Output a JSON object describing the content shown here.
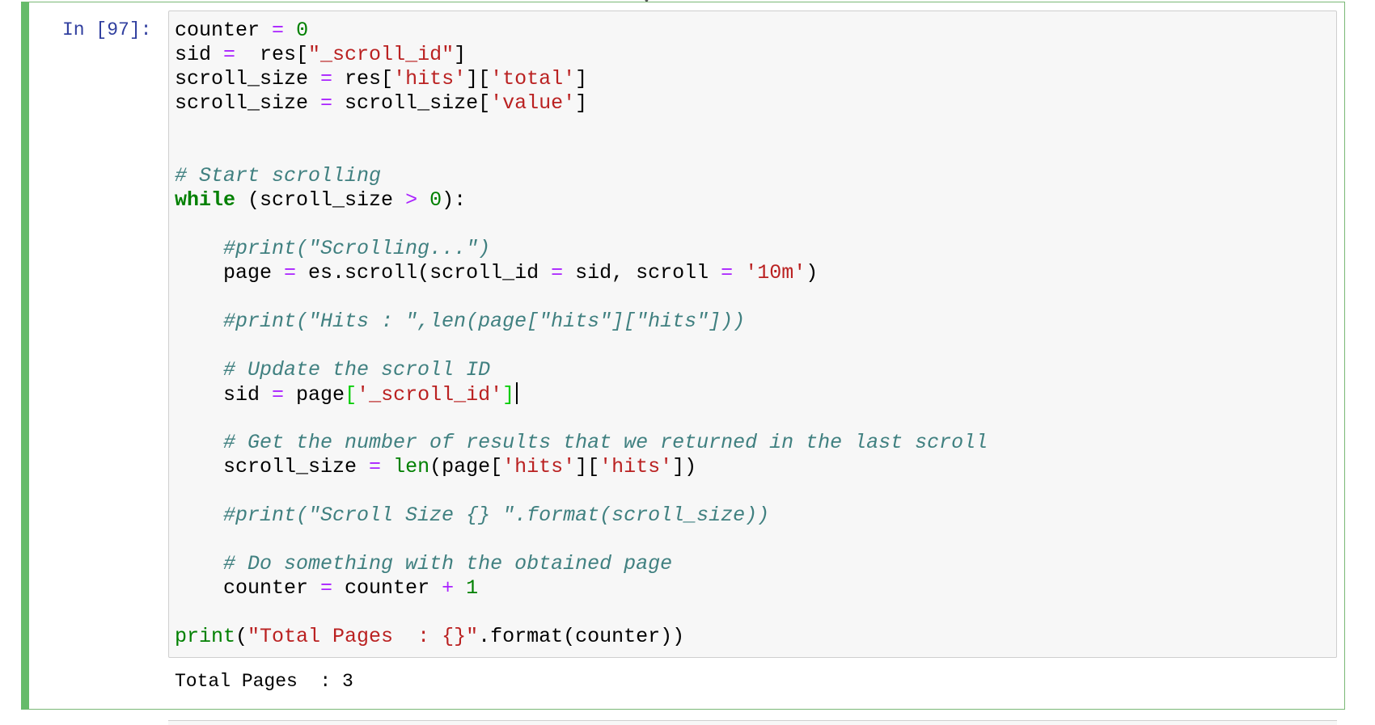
{
  "cell": {
    "prompt": "In [97]:",
    "code_lines": [
      [
        [
          "counter ",
          ""
        ],
        [
          "=",
          "o"
        ],
        [
          " ",
          ""
        ],
        [
          "0",
          "n0"
        ]
      ],
      [
        [
          "sid ",
          ""
        ],
        [
          "=",
          "o"
        ],
        [
          "  res[",
          ""
        ],
        [
          "\"_scroll_id\"",
          "s"
        ],
        [
          "]",
          ""
        ]
      ],
      [
        [
          "scroll_size ",
          ""
        ],
        [
          "=",
          "o"
        ],
        [
          " res[",
          ""
        ],
        [
          "'hits'",
          "s"
        ],
        [
          "][",
          ""
        ],
        [
          "'total'",
          "s"
        ],
        [
          "]",
          ""
        ]
      ],
      [
        [
          "scroll_size ",
          ""
        ],
        [
          "=",
          "o"
        ],
        [
          " scroll_size[",
          ""
        ],
        [
          "'value'",
          "s"
        ],
        [
          "]",
          ""
        ]
      ],
      [],
      [],
      [
        [
          "# Start scrolling",
          "c"
        ]
      ],
      [
        [
          "while",
          "k"
        ],
        [
          " (scroll_size ",
          ""
        ],
        [
          ">",
          "o"
        ],
        [
          " ",
          ""
        ],
        [
          "0",
          "n0"
        ],
        [
          "):",
          ""
        ]
      ],
      [],
      [
        [
          "    ",
          ""
        ],
        [
          "#print(\"Scrolling...\")",
          "c"
        ]
      ],
      [
        [
          "    page ",
          ""
        ],
        [
          "=",
          "o"
        ],
        [
          " es.scroll(scroll_id ",
          ""
        ],
        [
          "=",
          "o"
        ],
        [
          " sid, scroll ",
          ""
        ],
        [
          "=",
          "o"
        ],
        [
          " ",
          ""
        ],
        [
          "'10m'",
          "s"
        ],
        [
          ")",
          ""
        ]
      ],
      [],
      [
        [
          "    ",
          ""
        ],
        [
          "#print(\"Hits : \",len(page[\"hits\"][\"hits\"]))",
          "c"
        ]
      ],
      [],
      [
        [
          "    ",
          ""
        ],
        [
          "# Update the scroll ID",
          "c"
        ]
      ],
      [
        [
          "    sid ",
          ""
        ],
        [
          "=",
          "o"
        ],
        [
          " page",
          ""
        ],
        [
          "[",
          "mb"
        ],
        [
          "'_scroll_id'",
          "s"
        ],
        [
          "]",
          "mb"
        ],
        [
          "",
          "cursor"
        ]
      ],
      [],
      [
        [
          "    ",
          ""
        ],
        [
          "# Get the number of results that we returned in the last scroll",
          "c"
        ]
      ],
      [
        [
          "    scroll_size ",
          ""
        ],
        [
          "=",
          "o"
        ],
        [
          " ",
          ""
        ],
        [
          "len",
          "b"
        ],
        [
          "(page[",
          ""
        ],
        [
          "'hits'",
          "s"
        ],
        [
          "][",
          ""
        ],
        [
          "'hits'",
          "s"
        ],
        [
          "])",
          ""
        ]
      ],
      [],
      [
        [
          "    ",
          ""
        ],
        [
          "#print(\"Scroll Size {} \".format(scroll_size))",
          "c"
        ]
      ],
      [],
      [
        [
          "    ",
          ""
        ],
        [
          "# Do something with the obtained page",
          "c"
        ]
      ],
      [
        [
          "    counter ",
          ""
        ],
        [
          "=",
          "o"
        ],
        [
          " counter ",
          ""
        ],
        [
          "+",
          "o"
        ],
        [
          " ",
          ""
        ],
        [
          "1",
          "n0"
        ]
      ],
      [],
      [
        [
          "print",
          "b"
        ],
        [
          "(",
          ""
        ],
        [
          "\"Total Pages  : {}\"",
          "s"
        ],
        [
          ".format(counter))",
          ""
        ]
      ]
    ],
    "output_text": "Total Pages  : 3"
  },
  "colors": {
    "cell_border_selected": "#66bb6a",
    "prompt_color": "#303f9f",
    "input_background": "#f7f7f7",
    "keyword": "#008000",
    "operator": "#aa22ff",
    "string": "#ba2121",
    "comment": "#408080"
  }
}
